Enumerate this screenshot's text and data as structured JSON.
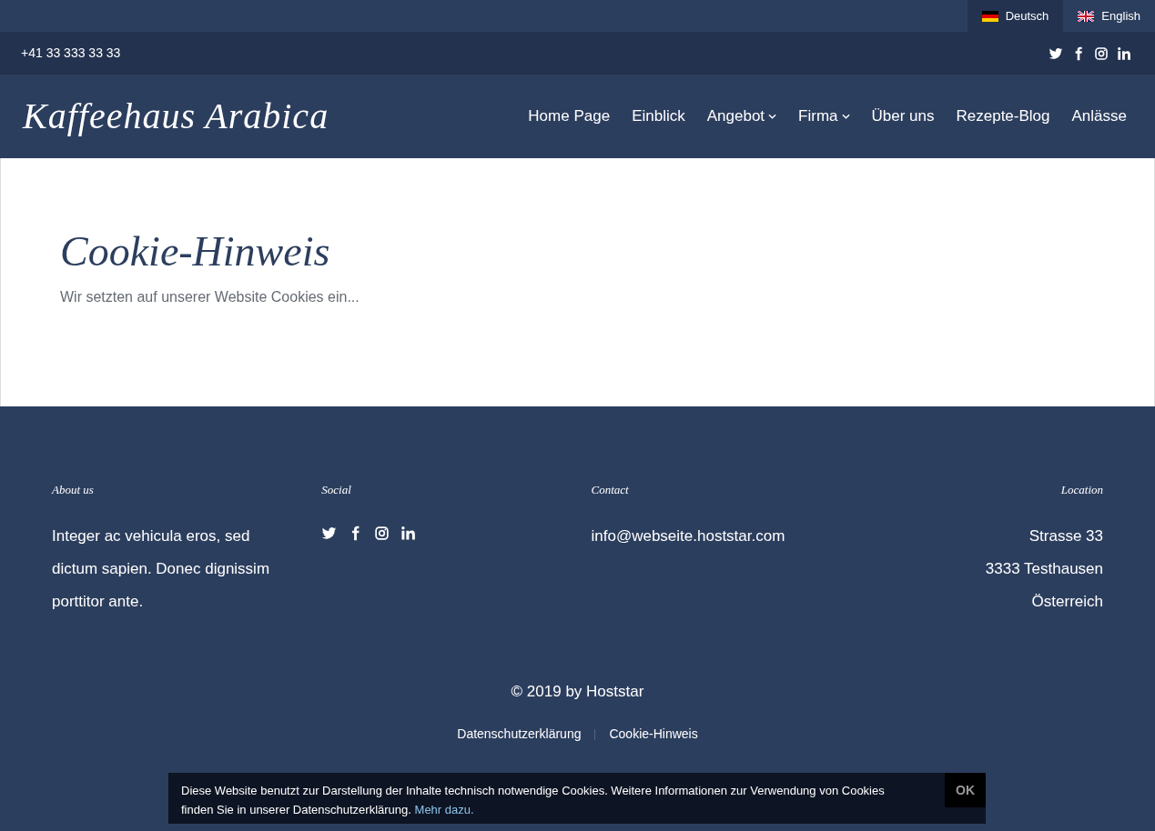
{
  "languages": [
    {
      "label": "Deutsch",
      "kind": "de",
      "selected": true
    },
    {
      "label": "English",
      "kind": "gb",
      "selected": false
    }
  ],
  "topbar": {
    "phone": "+41 33 333 33 33",
    "social": [
      {
        "kind": "twitter"
      },
      {
        "kind": "facebook"
      },
      {
        "kind": "instagram"
      },
      {
        "kind": "linkedin"
      }
    ]
  },
  "header": {
    "logo": "Kaffeehaus Arabica",
    "nav": [
      {
        "label": "Home Page",
        "has_menu": false
      },
      {
        "label": "Einblick",
        "has_menu": false
      },
      {
        "label": "Angebot",
        "has_menu": true
      },
      {
        "label": "Firma",
        "has_menu": true
      },
      {
        "label": "Über uns",
        "has_menu": false
      },
      {
        "label": "Rezepte-Blog",
        "has_menu": false
      },
      {
        "label": "Anlässe",
        "has_menu": false
      }
    ]
  },
  "content": {
    "title": "Cookie-Hinweis",
    "text": "Wir setzten auf unserer Website Cookies ein..."
  },
  "footer": {
    "columns": [
      {
        "kind": "text",
        "heading": "About us",
        "lines": [
          "Integer ac vehicula eros, sed dictum sapien. Donec dignissim porttitor ante."
        ]
      },
      {
        "kind": "social",
        "heading": "Social",
        "icons": [
          {
            "kind": "twitter"
          },
          {
            "kind": "facebook"
          },
          {
            "kind": "instagram"
          },
          {
            "kind": "linkedin"
          }
        ]
      },
      {
        "kind": "text",
        "heading": "Contact",
        "lines": [
          "info@webseite.hoststar.com"
        ]
      },
      {
        "kind": "right",
        "heading": "Location",
        "lines": [
          "Strasse 33",
          "3333 Testhausen",
          "Österreich"
        ]
      }
    ],
    "copyright": "© 2019 by Hoststar",
    "links": [
      "Datenschutzerklärung",
      "Cookie-Hinweis"
    ]
  },
  "cookie_banner": {
    "text": "Diese Website benutzt zur Darstellung der Inhalte technisch notwendige Cookies. Weitere Informationen zur Verwendung von Cookies finden Sie in unserer Datenschutzerklärung.",
    "link": "Mehr dazu.",
    "button": "OK"
  }
}
